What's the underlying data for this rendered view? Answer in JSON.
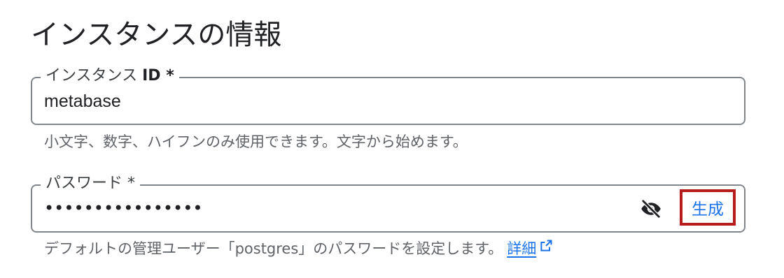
{
  "section": {
    "title": "インスタンスの情報"
  },
  "instance_id_field": {
    "label": "インスタンス ",
    "label_bold": "ID *",
    "value": "metabase",
    "helper": "小文字、数字、ハイフンのみ使用できます。文字から始めます。"
  },
  "password_field": {
    "label": "パスワード *",
    "masked_value": "••••••••••••••••",
    "visibility_icon": "visibility-off-icon",
    "generate_label": "生成",
    "helper": "デフォルトの管理ユーザー「postgres」のパスワードを設定します。",
    "learn_more_label": "詳細",
    "learn_more_icon": "open-in-new-icon"
  },
  "colors": {
    "accent": "#1a73e8",
    "highlight_border": "#b71c1c",
    "field_border": "#80868b",
    "helper_text": "#5f6368"
  }
}
